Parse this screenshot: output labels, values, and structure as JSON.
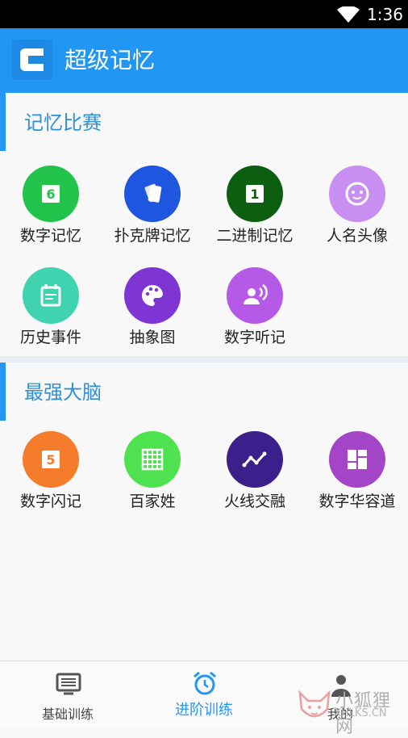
{
  "status_bar": {
    "time": "1:36"
  },
  "app_bar": {
    "title": "超级记忆"
  },
  "sections": [
    {
      "title": "记忆比赛",
      "items": [
        {
          "label": "数字记忆",
          "icon": "number-6-icon",
          "color": "#22c34a"
        },
        {
          "label": "扑克牌记忆",
          "icon": "cards-icon",
          "color": "#1e56e0"
        },
        {
          "label": "二进制记忆",
          "icon": "number-1-icon",
          "color": "#0c5e10"
        },
        {
          "label": "人名头像",
          "icon": "face-icon",
          "color": "#c98ef2"
        },
        {
          "label": "历史事件",
          "icon": "calendar-icon",
          "color": "#3fd3b0"
        },
        {
          "label": "抽象图",
          "icon": "palette-icon",
          "color": "#7e35d4"
        },
        {
          "label": "数字听记",
          "icon": "voice-icon",
          "color": "#b45ae6"
        }
      ]
    },
    {
      "title": "最强大脑",
      "items": [
        {
          "label": "数字闪记",
          "icon": "number-5-icon",
          "color": "#f47c2b"
        },
        {
          "label": "百家姓",
          "icon": "grid-icon",
          "color": "#4ee150"
        },
        {
          "label": "火线交融",
          "icon": "line-chart-icon",
          "color": "#3b1f8b"
        },
        {
          "label": "数字华容道",
          "icon": "dashboard-icon",
          "color": "#a445c7"
        }
      ]
    }
  ],
  "bottom_nav": [
    {
      "label": "基础训练",
      "icon": "monitor-list-icon",
      "active": false
    },
    {
      "label": "进阶训练",
      "icon": "alarm-clock-icon",
      "active": true
    },
    {
      "label": "我的",
      "icon": "person-icon",
      "active": false
    }
  ],
  "watermark": {
    "text": "小狐狸网",
    "url": "XHLKS.CN"
  }
}
